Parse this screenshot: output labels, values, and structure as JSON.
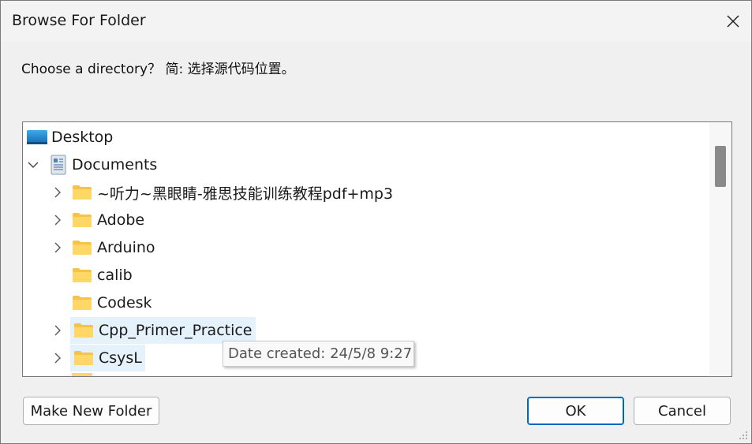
{
  "window": {
    "title": "Browse For Folder"
  },
  "prompt": "Choose a directory？ 简: 选择源代码位置。",
  "tree": {
    "items": [
      {
        "label": "Desktop",
        "icon": "desktop-icon",
        "expanded": null
      },
      {
        "label": "Documents",
        "icon": "documents-icon",
        "expanded": true
      },
      {
        "label": "~听力~黑眼睛-雅思技能训练教程pdf+mp3",
        "icon": "folder-icon",
        "expanded": false
      },
      {
        "label": "Adobe",
        "icon": "folder-icon",
        "expanded": false
      },
      {
        "label": "Arduino",
        "icon": "folder-icon",
        "expanded": false
      },
      {
        "label": "calib",
        "icon": "folder-icon",
        "expanded": null
      },
      {
        "label": "Codesk",
        "icon": "folder-icon",
        "expanded": null
      },
      {
        "label": "Cpp_Primer_Practice",
        "icon": "folder-icon",
        "expanded": false,
        "state": "hover"
      },
      {
        "label": "CsysL",
        "icon": "folder-icon",
        "expanded": false,
        "state": "selected"
      }
    ]
  },
  "tooltip": "Date created: 24/5/8 9:27",
  "buttons": {
    "make_new_folder": "Make New Folder",
    "ok": "OK",
    "cancel": "Cancel"
  },
  "colors": {
    "hover": "#e5f1fb",
    "accent": "#0067c0",
    "folder": "#f8c94b"
  }
}
